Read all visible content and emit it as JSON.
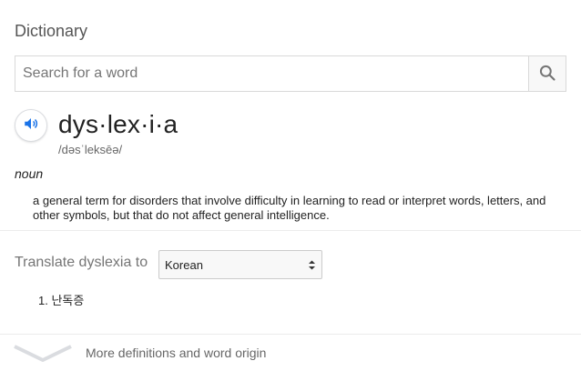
{
  "dictionary": {
    "title": "Dictionary",
    "search": {
      "placeholder": "Search for a word",
      "value": ""
    },
    "entry": {
      "word": "dys·lex·i·a",
      "phonetic": "/dəsˈleksēə/",
      "part_of_speech": "noun",
      "definition": "a general term for disorders that involve difficulty in learning to read or interpret words, letters, and other symbols, but that do not affect general intelligence."
    },
    "translate": {
      "label": "Translate dyslexia to",
      "selected_language": "Korean",
      "results": [
        "1. 난독증"
      ]
    },
    "footer": {
      "more_label": "More definitions and word origin"
    }
  },
  "icons": {
    "search": "search-icon",
    "speaker": "speaker-icon",
    "expand": "chevron-down-icon"
  },
  "colors": {
    "speaker_accent": "#1a73e8",
    "search_icon": "#757575"
  }
}
